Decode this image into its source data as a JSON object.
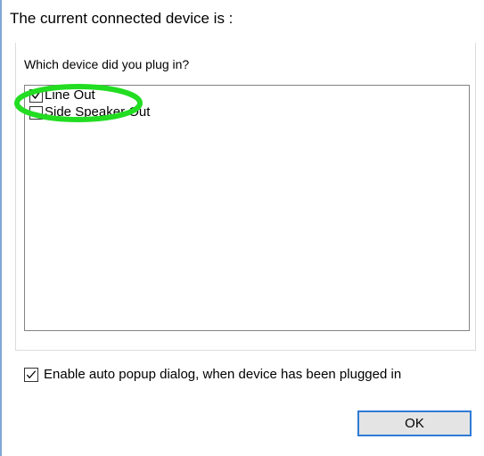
{
  "dialog": {
    "title": "The current connected device is :"
  },
  "device_group": {
    "caption": "Which device did you plug in?",
    "items": [
      {
        "label": "Line Out",
        "checked": true
      },
      {
        "label": "Side Speaker Out",
        "checked": false
      }
    ]
  },
  "auto_popup": {
    "label": "Enable auto popup dialog, when device has been plugged in",
    "checked": true
  },
  "buttons": {
    "ok_label": "OK"
  },
  "colors": {
    "highlight_ring": "#22dd22",
    "ok_button_border": "#2f7bd6",
    "window_edge": "#7fa7d6"
  }
}
